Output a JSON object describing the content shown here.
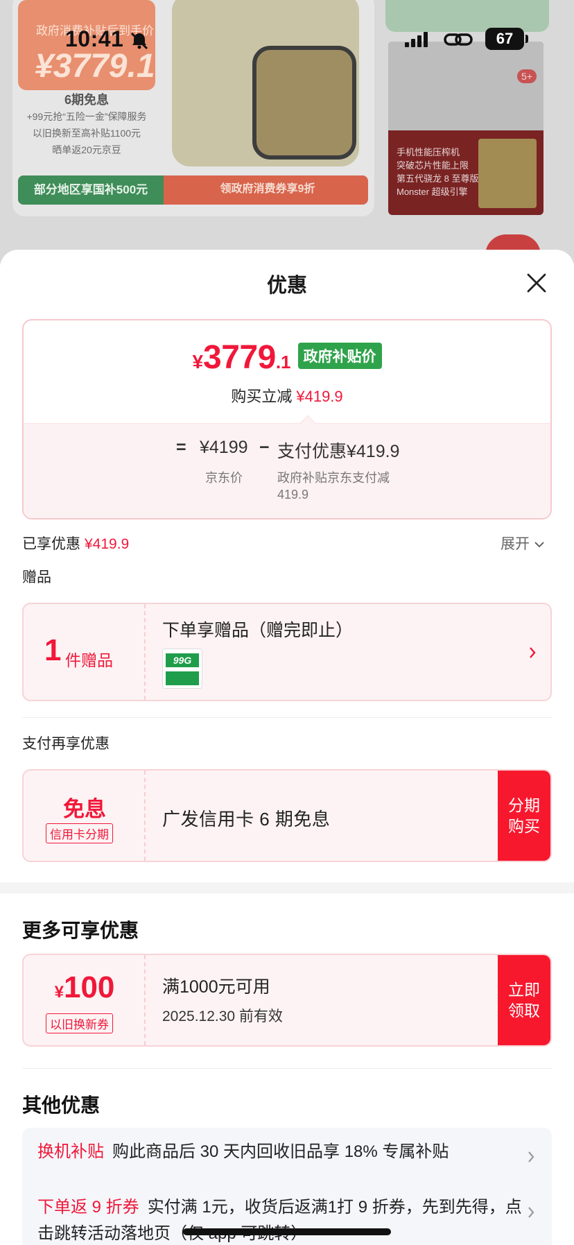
{
  "status_bar": {
    "time": "10:41",
    "battery": "67"
  },
  "background": {
    "promo_title": "政府消费补贴后到手价",
    "promo_price": "¥3779.1",
    "lines": [
      "6期免息",
      "+99元抢“五险一金”保障服务",
      "以旧换新至高补贴1100元",
      "晒单返20元京豆"
    ],
    "banner_left": "部分地区享国补500元",
    "banner_right": "领政府消费券享9折",
    "right_text": [
      "手机性能压榨机",
      "突破芯片性能上限",
      "第五代骁龙 8 至尊版",
      "Monster 超级引擎"
    ],
    "badge": "5+"
  },
  "sheet": {
    "title": "优惠",
    "price": {
      "symbol": "¥",
      "integer": "3779",
      "decimal": ".1",
      "tag": "政府补贴价"
    },
    "save": {
      "label": "购买立减",
      "amount": "¥419.9"
    },
    "formula": {
      "equals": "=",
      "jd_price": "¥4199",
      "minus": "−",
      "pay_discount": "支付优惠¥419.9",
      "jd_label": "京东价",
      "pay_desc": "政府补贴京东支付减419.9"
    },
    "enjoyed": {
      "label": "已享优惠",
      "amount": "¥419.9",
      "expand": "展开"
    },
    "gift": {
      "section": "赠品",
      "count": "1",
      "unit": "件赠品",
      "title": "下单享赠品（赠完即止）",
      "thumb_text": "99G"
    },
    "pay": {
      "section": "支付再享优惠",
      "big": "免息",
      "tag": "信用卡分期",
      "text": "广发信用卡 6 期免息",
      "button": "分期购买"
    },
    "more": {
      "title": "更多可享优惠",
      "symbol": "¥",
      "amount": "100",
      "tag": "以旧换新券",
      "cond": "满1000元可用",
      "expiry": "2025.12.30 前有效",
      "button": "立即领取"
    },
    "other": {
      "title": "其他优惠",
      "rows": [
        {
          "key": "换机补贴",
          "text": "购此商品后 30 天内回收旧品享 18% 专属补贴"
        },
        {
          "key": "下单返 9 折券",
          "text": "实付满 1元，收货后返满1打 9 折券，先到先得，点击跳转活动落地页（仅 app 可跳转）"
        }
      ]
    }
  }
}
